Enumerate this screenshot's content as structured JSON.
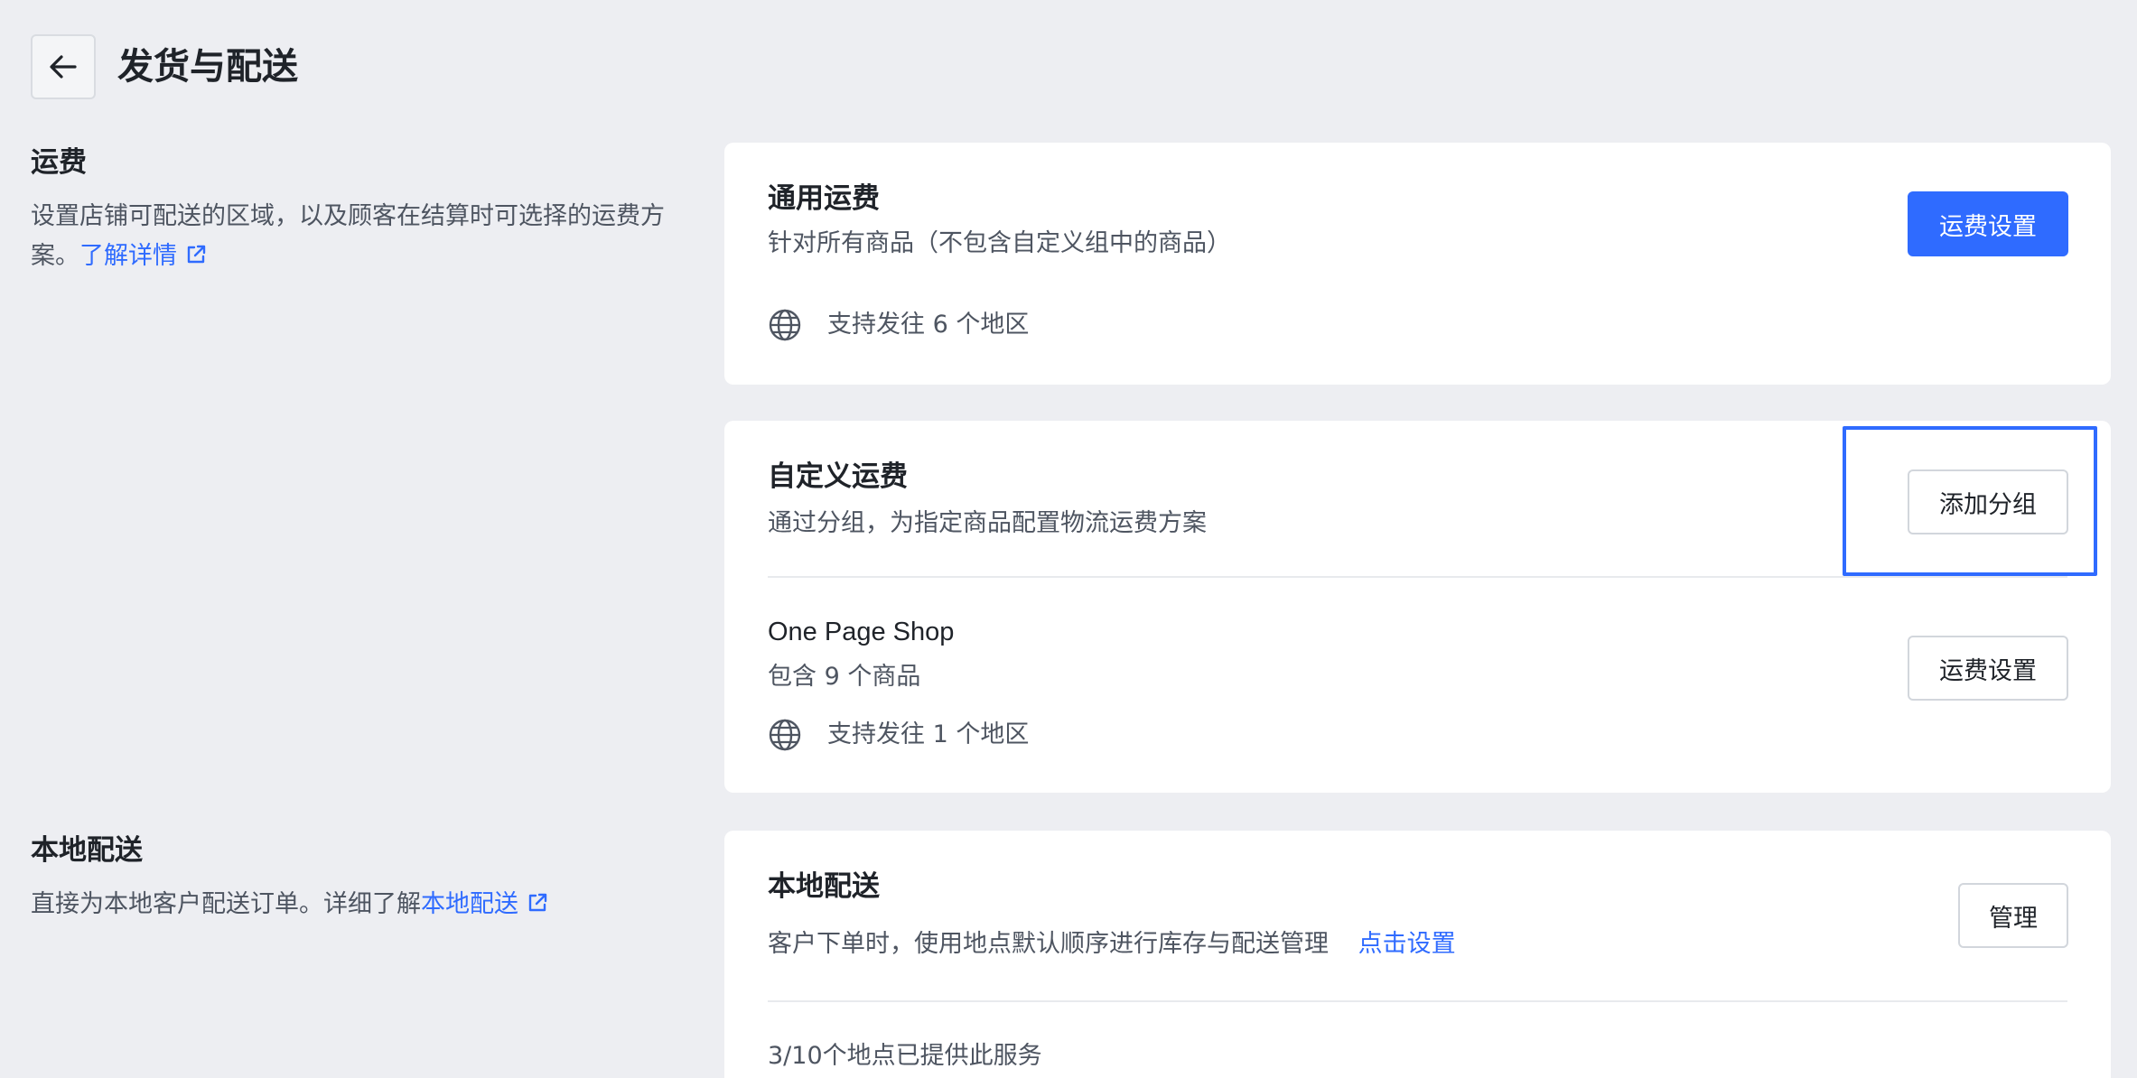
{
  "header": {
    "title": "发货与配送",
    "back_icon": "arrow-left-icon"
  },
  "shipping_section": {
    "title": "运费",
    "desc": "设置店铺可配送的区域，以及顾客在结算时可选择的运费方案。",
    "link": "了解详情"
  },
  "general_card": {
    "title": "通用运费",
    "subtitle": "针对所有商品（不包含自定义组中的商品）",
    "regions": "支持发往 6 个地区",
    "button": "运费设置"
  },
  "custom_card": {
    "title": "自定义运费",
    "subtitle": "通过分组，为指定商品配置物流运费方案",
    "add_button": "添加分组",
    "group": {
      "name": "One Page Shop",
      "count": "包含 9 个商品",
      "regions": "支持发往 1 个地区",
      "button": "运费设置"
    }
  },
  "local_section": {
    "title": "本地配送",
    "desc": "直接为本地客户配送订单。详细了解",
    "link": "本地配送"
  },
  "local_card": {
    "title": "本地配送",
    "subtitle": "客户下单时，使用地点默认顺序进行库存与配送管理",
    "subtitle_link": "点击设置",
    "button": "管理",
    "locations": "3/10个地点已提供此服务"
  },
  "colors": {
    "accent": "#2f6bff",
    "background": "#edeef2",
    "card": "#ffffff"
  }
}
